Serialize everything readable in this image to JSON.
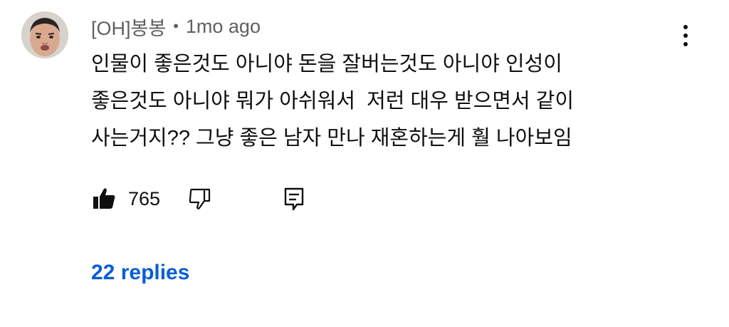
{
  "comment": {
    "author": "[OH]봉봉",
    "separator": "•",
    "timestamp": "1mo ago",
    "text_lines": [
      "인물이 좋은것도 아니야 돈을 잘버는것도 아니야 인성이",
      "좋은것도 아니야 뭐가 아쉬워서  저런 대우 받으면서 같이",
      "사는거지?? 그냥 좋은 남자 만나 재혼하는게 훨 나아보임"
    ],
    "like_count": "765",
    "replies_label": "22 replies"
  },
  "icons": {
    "avatar": "user-avatar",
    "menu": "more-vert-icon",
    "like": "thumb-up-icon",
    "dislike": "thumb-down-icon",
    "reply": "reply-comment-icon"
  },
  "colors": {
    "text": "#0f0f0f",
    "secondary": "#606060",
    "link": "#065fd4"
  }
}
